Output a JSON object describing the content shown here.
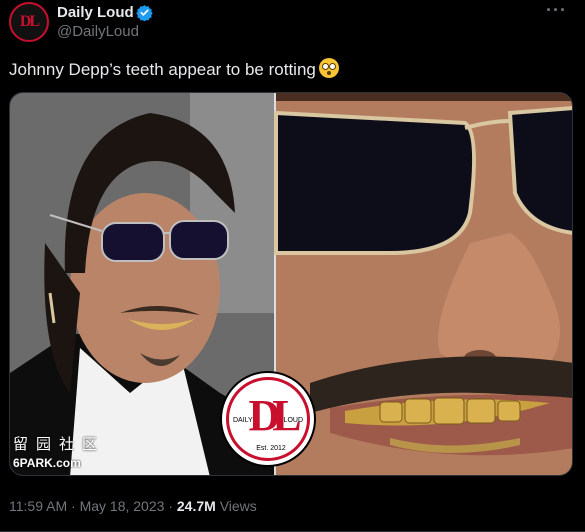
{
  "author": {
    "display_name": "Daily Loud",
    "handle": "@DailyLoud",
    "avatar_text": "DL",
    "verified_icon": "verified-badge-icon",
    "verified_color": "#1d9bf0"
  },
  "more_icon": "more-options-icon",
  "tweet": {
    "text": "Johnny Depp’s teeth appear to be rotting",
    "emoji": "flushed-face-emoji"
  },
  "media": {
    "watermark_cn": "留园社区",
    "watermark_en": "6PARK.com",
    "logo": {
      "letters": "DL",
      "left_text": "DAILY",
      "right_text": "LOUD",
      "est_text": "Est. 2012",
      "color": "#c8102e"
    }
  },
  "meta": {
    "time": "11:59 AM",
    "separator": "·",
    "date": "May 18, 2023",
    "views_count": "24.7M",
    "views_label": "Views"
  }
}
